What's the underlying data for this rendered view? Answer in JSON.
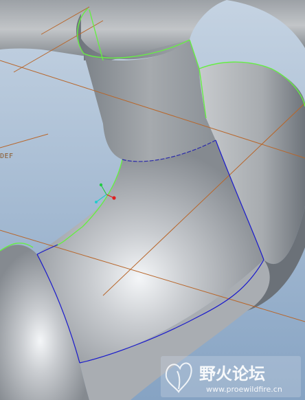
{
  "viewport": {
    "datum_label": "DEF",
    "background_top": "#c9d6e4",
    "background_bottom": "#7f9dbf"
  },
  "model": {
    "surface_color": "#b9bcc0",
    "edge_highlight_color": "#66ee44",
    "selected_edge_color": "#1a1acc",
    "datum_plane_color": "#b8662a"
  },
  "csys": {
    "x_color": "#e02020",
    "y_color": "#22cc44",
    "z_color": "#22cccc"
  },
  "watermark": {
    "title": "野火论坛",
    "url": "www.proewildfire.cn",
    "logo_name": "proewildfire-logo"
  }
}
